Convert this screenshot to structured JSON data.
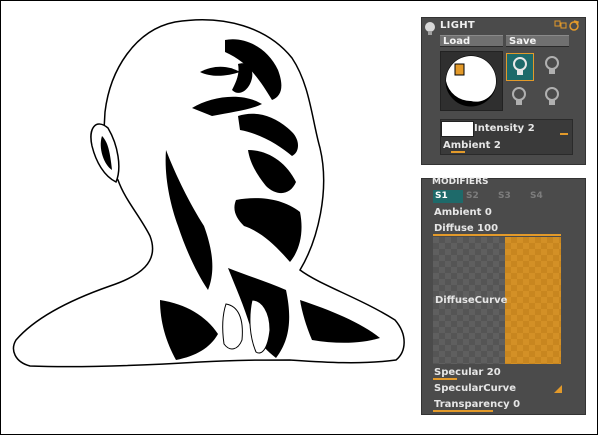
{
  "light_panel": {
    "title": "LIGHT",
    "load_label": "Load",
    "save_label": "Save",
    "intensity_label": "Intensity",
    "intensity_value": "2",
    "ambient_label": "Ambient",
    "ambient_value": "2",
    "color_swatch": "#ffffff",
    "accent": "#e39a2a"
  },
  "modifiers_panel": {
    "title": "MODIFIERS",
    "tabs": [
      "S1",
      "S2",
      "S3",
      "S4"
    ],
    "active_tab": "S1",
    "ambient_label": "Ambient",
    "ambient_value": "0",
    "diffuse_label": "Diffuse",
    "diffuse_value": "100",
    "curve_label": "DiffuseCurve",
    "specular_label": "Specular",
    "specular_value": "20",
    "specular_curve_label": "SpecularCurve",
    "transparency_label": "Transparency",
    "transparency_value": "0"
  }
}
